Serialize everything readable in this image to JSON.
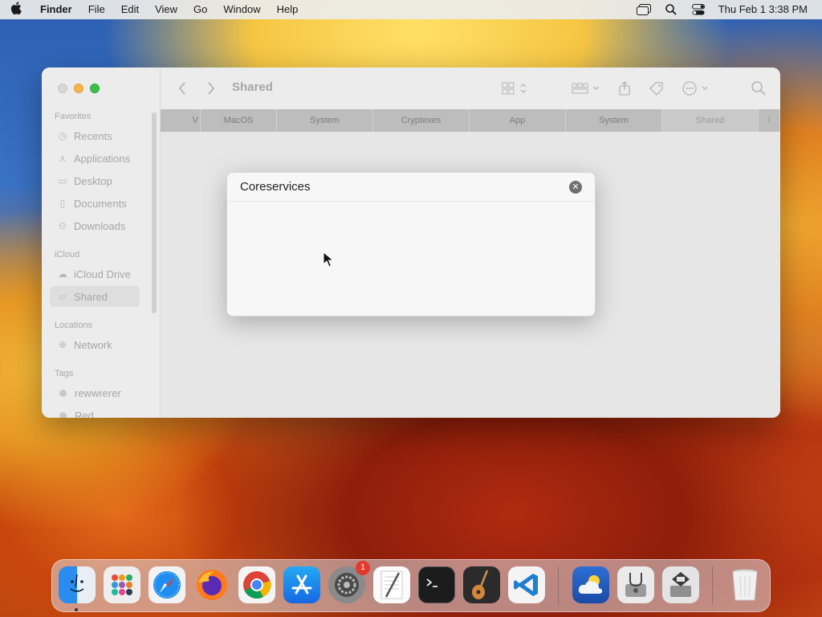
{
  "menubar": {
    "app_name": "Finder",
    "items": [
      "File",
      "Edit",
      "View",
      "Go",
      "Window",
      "Help"
    ],
    "clock": "Thu Feb 1  3:38 PM",
    "status_icons": [
      "window-stack-icon",
      "search-icon",
      "control-center-icon"
    ]
  },
  "finder": {
    "title": "Shared",
    "sidebar": {
      "favorites_label": "Favorites",
      "favorites": [
        {
          "label": "Recents",
          "icon": "clock-icon"
        },
        {
          "label": "Applications",
          "icon": "applications-icon"
        },
        {
          "label": "Desktop",
          "icon": "desktop-icon"
        },
        {
          "label": "Documents",
          "icon": "document-icon"
        },
        {
          "label": "Downloads",
          "icon": "download-icon"
        }
      ],
      "icloud_label": "iCloud",
      "icloud": [
        {
          "label": "iCloud Drive",
          "icon": "cloud-icon"
        },
        {
          "label": "Shared",
          "icon": "shared-folder-icon",
          "selected": true
        }
      ],
      "locations_label": "Locations",
      "locations": [
        {
          "label": "Network",
          "icon": "globe-icon"
        }
      ],
      "tags_label": "Tags",
      "tags": [
        {
          "label": "rewwrerer"
        },
        {
          "label": "Red"
        }
      ]
    },
    "columns": [
      "V",
      "MacOS",
      "System",
      "Cryptexes",
      "App",
      "System",
      "Shared",
      "I"
    ]
  },
  "dialog": {
    "title": "Coreservices"
  },
  "dock": {
    "apps": [
      {
        "name": "Finder",
        "icon": "finder-icon"
      },
      {
        "name": "Launchpad",
        "icon": "launchpad-icon"
      },
      {
        "name": "Safari",
        "icon": "safari-icon"
      },
      {
        "name": "Firefox",
        "icon": "firefox-icon"
      },
      {
        "name": "Chrome",
        "icon": "chrome-icon"
      },
      {
        "name": "App Store",
        "icon": "app-store-icon"
      },
      {
        "name": "System Settings",
        "icon": "settings-icon",
        "badge": "1"
      },
      {
        "name": "TextEdit",
        "icon": "textedit-icon"
      },
      {
        "name": "Terminal",
        "icon": "terminal-icon"
      },
      {
        "name": "GarageBand",
        "icon": "guitar-icon"
      },
      {
        "name": "VS Code",
        "icon": "vscode-icon"
      },
      {
        "name": "Weather",
        "icon": "weather-icon"
      },
      {
        "name": "Disk Utility",
        "icon": "disk-utility-icon"
      },
      {
        "name": "Boot Camp Assistant",
        "icon": "bootcamp-icon"
      },
      {
        "name": "Trash",
        "icon": "trash-icon"
      }
    ]
  }
}
